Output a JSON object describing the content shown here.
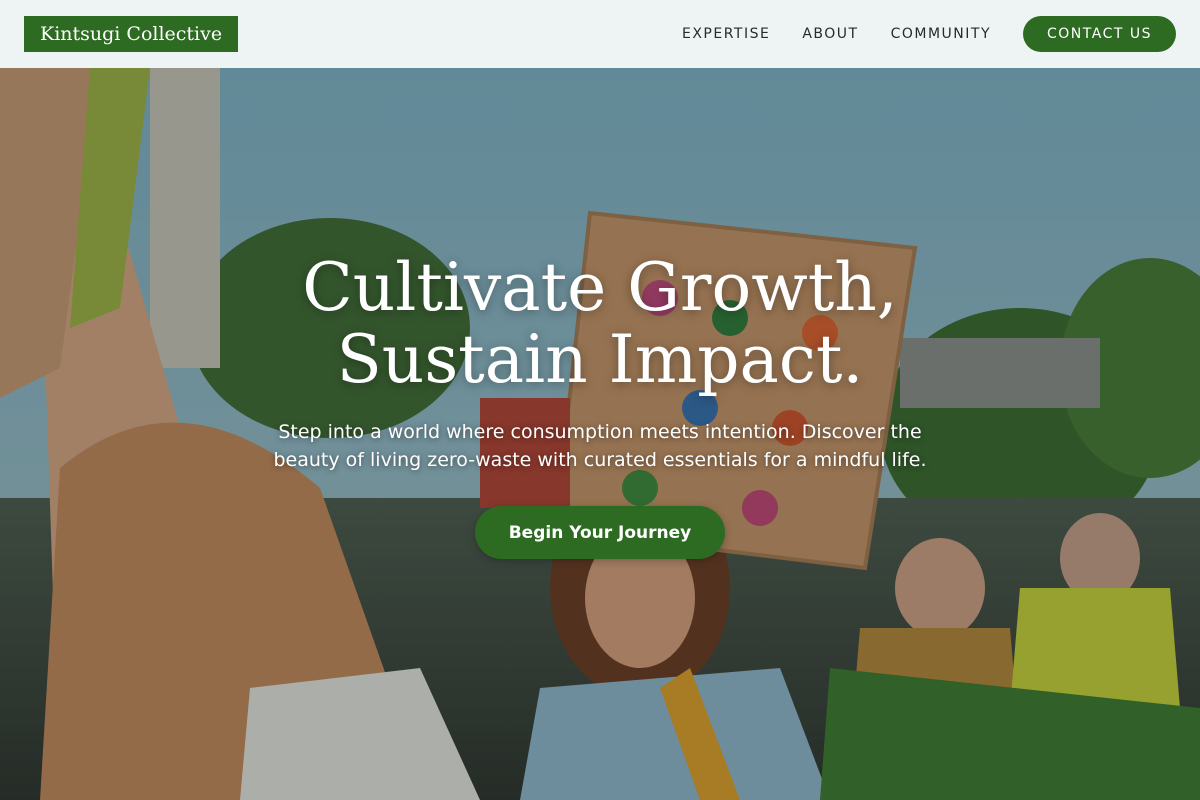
{
  "header": {
    "logo": "Kintsugi Collective",
    "nav": [
      {
        "label": "EXPERTISE"
      },
      {
        "label": "ABOUT"
      },
      {
        "label": "COMMUNITY"
      }
    ],
    "contact_label": "CONTACT US"
  },
  "hero": {
    "title_line1": "Cultivate Growth,",
    "title_line2": "Sustain Impact.",
    "subtitle": "Step into a world where consumption meets intention. Discover the beauty of living zero-waste with curated essentials for a mindful life.",
    "cta_label": "Begin Your Journey",
    "background_description_visual": "protest crowd photo"
  },
  "colors": {
    "brand_green": "#2e6b22",
    "header_bg": "#eef4f3"
  }
}
